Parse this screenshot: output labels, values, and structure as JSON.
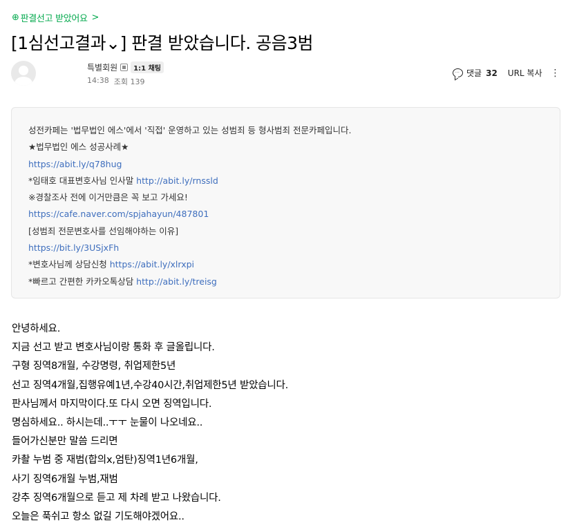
{
  "board_link": "판결선고 받았어요",
  "title": "[1심선고결과⌄] 판결 받았습니다. 공음3범",
  "author": {
    "name": "특별회원",
    "chat_label": "1:1 채팅"
  },
  "meta": {
    "time": "14:38",
    "views_label": "조회",
    "views": "139"
  },
  "tools": {
    "comment_label": "댓글",
    "comment_count": "32",
    "url_copy": "URL 복사"
  },
  "promo": {
    "lines": [
      {
        "text": "성전카페는 '법무법인 에스'에서 '직접' 운영하고 있는 성범죄 등 형사범죄 전문카페입니다.",
        "link": ""
      },
      {
        "text": "★법무법인 에스 성공사례★",
        "link": ""
      },
      {
        "text": "",
        "link": "https://abit.ly/q78hug"
      },
      {
        "text": "*임태호 대표변호사님 인사말 ",
        "link": "http://abit.ly/rnssld"
      },
      {
        "text": "※경찰조사 전에 이거만큼은 꼭 보고 가세요!",
        "link": ""
      },
      {
        "text": "",
        "link": "https://cafe.naver.com/spjahayun/487801"
      },
      {
        "text": "[성범죄 전문변호사를 선임해야하는 이유]",
        "link": ""
      },
      {
        "text": "",
        "link": "https://bit.ly/3USjxFh"
      },
      {
        "text": "*변호사님께 상담신청 ",
        "link": "https://abit.ly/xlrxpi"
      },
      {
        "text": "*빠르고 간편한 카카오톡상담 ",
        "link": "http://abit.ly/treisg"
      }
    ]
  },
  "body_lines": [
    "안녕하세요.",
    "지금 선고 받고 변호사님이랑 통화 후 글올립니다.",
    "구형 징역8개월, 수강명령, 취업제한5년",
    "선고 징역4개월,집행유예1년,수강40시간,취업제한5년 받았습니다.",
    "판사님께서 마지막이다.또 다시 오면 징역입니다.",
    "명심하세요.. 하시는데..ㅜㅜ 눈물이 나오네요..",
    "들어가신분만 말씀 드리면",
    "카촬 누범 중 재범(합의x,엄탄)징역1년6개월,",
    "사기 징역6개월 누범,재범",
    "강추 징역6개월으로 듣고 제 차례 받고 나왔습니다.",
    "오늘은 푹쉬고 항소 없길 기도해야겠어요.."
  ],
  "colors": {
    "accent": "#03a94d",
    "link": "#3e6ebd"
  }
}
